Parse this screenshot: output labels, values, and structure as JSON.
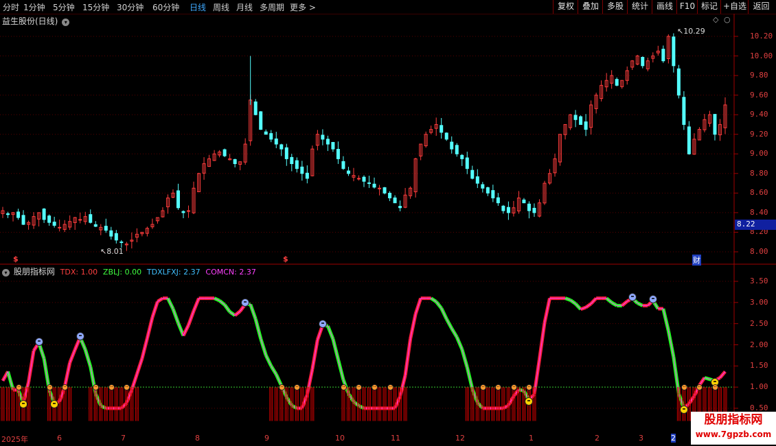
{
  "toolbar": {
    "periods": [
      "分时",
      "1分钟",
      "5分钟",
      "15分钟",
      "30分钟",
      "60分钟",
      "日线",
      "周线",
      "月线",
      "多周期",
      "更多 >"
    ],
    "active_period": "日线",
    "right_buttons": [
      "复权",
      "叠加",
      "多股",
      "统计",
      "画线",
      "F10",
      "标记",
      "+自选",
      "返回"
    ]
  },
  "main_panel": {
    "title": "益生股份(日线)",
    "high_label": "10.29",
    "low_label": "8.01",
    "current_price_label": "8.22",
    "y_ticks": [
      "10.20",
      "10.00",
      "9.80",
      "9.60",
      "9.40",
      "9.20",
      "9.00",
      "8.80",
      "8.60",
      "8.40",
      "8.20",
      "8.00"
    ],
    "event_markers": [
      "$",
      "$",
      "财"
    ]
  },
  "indicator_panel": {
    "title": "股朋指标网",
    "legend": [
      {
        "label": "TDX: 1.00",
        "color": "#ff4040"
      },
      {
        "label": "ZBLJ: 0.00",
        "color": "#40ff40"
      },
      {
        "label": "TDXLFXJ: 2.37",
        "color": "#40c0ff"
      },
      {
        "label": "COMCN: 2.37",
        "color": "#ff40ff"
      }
    ],
    "y_ticks": [
      "3.50",
      "3.00",
      "2.50",
      "2.00",
      "1.50",
      "1.00",
      "0.50"
    ]
  },
  "x_axis": {
    "labels": [
      "2025年",
      "6",
      "7",
      "8",
      "9",
      "10",
      "11",
      "12",
      "1",
      "2",
      "3",
      "2"
    ]
  },
  "watermark": {
    "name": "股朋指标网",
    "url": "www.7gpzb.com"
  },
  "chart_data": [
    {
      "type": "candlestick",
      "title": "益生股份(日线)",
      "ylim": [
        7.95,
        10.35
      ],
      "y_ticks": [
        10.2,
        10.0,
        9.8,
        9.6,
        9.4,
        9.2,
        9.0,
        8.8,
        8.6,
        8.4,
        8.2,
        8.0
      ],
      "close": [
        8.42,
        8.38,
        8.4,
        8.35,
        8.28,
        8.3,
        8.36,
        8.4,
        8.33,
        8.3,
        8.27,
        8.25,
        8.28,
        8.31,
        8.35,
        8.33,
        8.36,
        8.3,
        8.26,
        8.25,
        8.22,
        8.16,
        8.12,
        8.1,
        8.08,
        8.12,
        8.18,
        8.2,
        8.24,
        8.28,
        8.35,
        8.42,
        8.55,
        8.6,
        8.45,
        8.4,
        8.42,
        8.65,
        8.8,
        8.9,
        8.95,
        9.0,
        9.02,
        8.98,
        8.95,
        8.9,
        8.92,
        9.1,
        9.55,
        9.4,
        9.25,
        9.2,
        9.15,
        9.1,
        9.05,
        8.95,
        8.9,
        8.85,
        8.8,
        8.75,
        9.05,
        9.2,
        9.15,
        9.1,
        9.05,
        8.95,
        8.85,
        8.8,
        8.78,
        8.75,
        8.72,
        8.7,
        8.66,
        8.65,
        8.6,
        8.55,
        8.5,
        8.45,
        8.58,
        8.65,
        8.95,
        9.1,
        9.2,
        9.25,
        9.3,
        9.22,
        9.15,
        9.05,
        9.0,
        8.95,
        8.85,
        8.75,
        8.7,
        8.65,
        8.6,
        8.55,
        8.5,
        8.42,
        8.4,
        8.45,
        8.55,
        8.5,
        8.42,
        8.4,
        8.5,
        8.7,
        8.8,
        8.95,
        9.2,
        9.3,
        9.4,
        9.35,
        9.3,
        9.25,
        9.5,
        9.6,
        9.7,
        9.75,
        9.8,
        9.7,
        9.75,
        9.85,
        9.95,
        10.0,
        9.9,
        9.95,
        10.0,
        10.05,
        9.95,
        10.2,
        9.9,
        9.6,
        9.3,
        9.0,
        9.15,
        9.25,
        9.35,
        9.4,
        9.2,
        9.3,
        9.5
      ],
      "high": 10.29,
      "low": 8.01,
      "last": 8.22
    }
  ]
}
